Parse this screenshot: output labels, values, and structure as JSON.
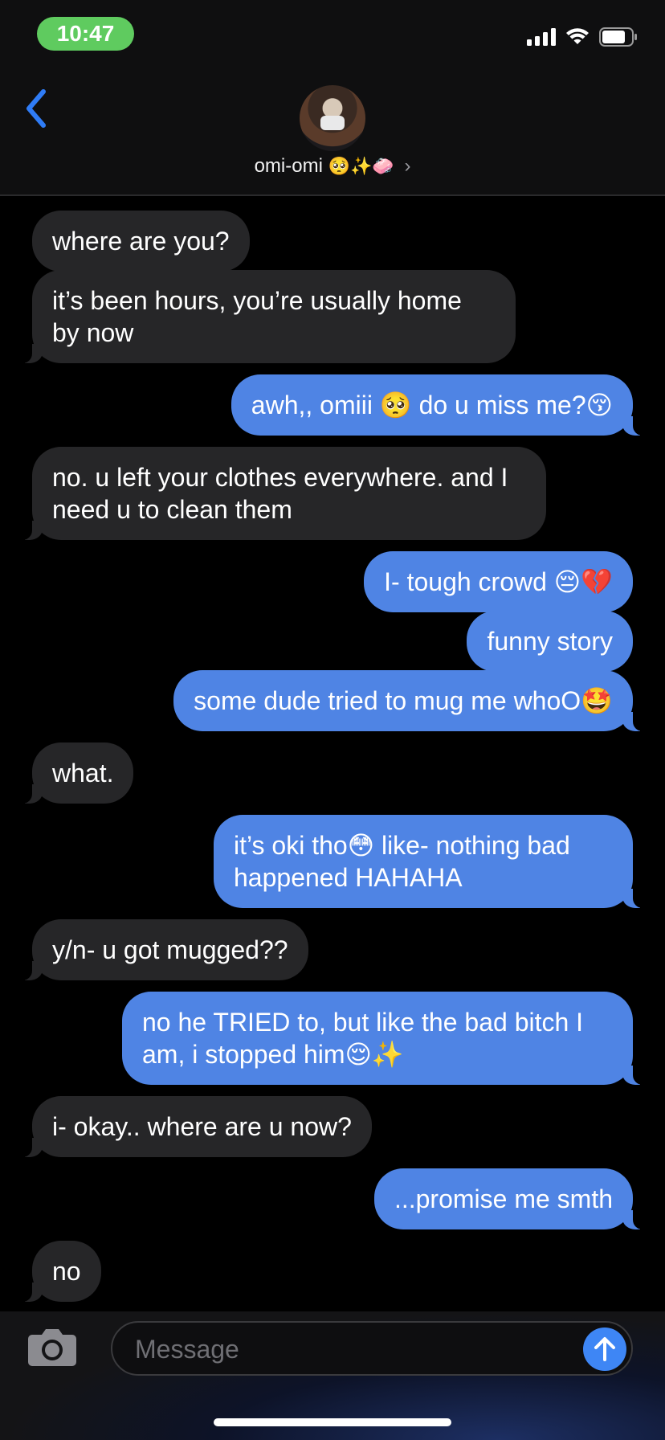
{
  "status": {
    "time": "10:47"
  },
  "header": {
    "name": "omi-omi",
    "emojis": "🥺✨🧼"
  },
  "messages": [
    {
      "side": "in",
      "text": "where are you?"
    },
    {
      "side": "in",
      "text": "it’s been hours, you’re usually home by now"
    },
    {
      "side": "out",
      "text": "awh,, omiii 🥺 do u miss me?😚"
    },
    {
      "side": "in",
      "text": "no. u left your clothes everywhere. and I need u to clean them"
    },
    {
      "side": "out",
      "text": "I- tough crowd 😔💔"
    },
    {
      "side": "out",
      "text": "funny story"
    },
    {
      "side": "out",
      "text": "some dude tried to mug me whoO🤩"
    },
    {
      "side": "in",
      "text": "what."
    },
    {
      "side": "out",
      "text": "it’s oki tho😳 like- nothing bad happened HAHAHA"
    },
    {
      "side": "in",
      "text": "y/n- u got mugged??"
    },
    {
      "side": "out",
      "text": "no he TRIED to, but like the bad bitch I am, i stopped him😌✨"
    },
    {
      "side": "in",
      "text": "i- okay.. where are u now?"
    },
    {
      "side": "out",
      "text": "...promise me smth"
    },
    {
      "side": "in",
      "text": "no"
    }
  ],
  "compose": {
    "placeholder": "Message"
  },
  "colors": {
    "incoming": "#262628",
    "outgoing": "#4f84e4",
    "accent": "#3e86f5",
    "time_pill": "#5fcb5f"
  },
  "icons": [
    "back-chevron-icon",
    "signal-icon",
    "wifi-icon",
    "battery-icon",
    "camera-icon",
    "send-arrow-icon"
  ]
}
